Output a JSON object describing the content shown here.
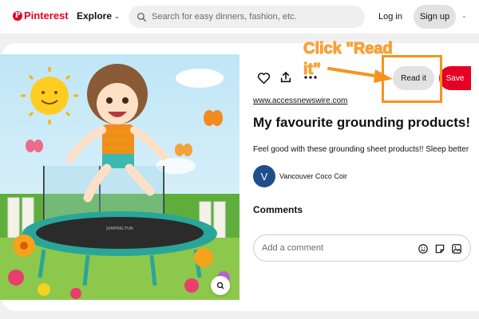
{
  "header": {
    "logo_text": "Pinterest",
    "explore_label": "Explore",
    "search_placeholder": "Search for easy dinners, fashion, etc.",
    "login_label": "Log in",
    "signup_label": "Sign up"
  },
  "pin": {
    "image_caption": "JUMPING FUN",
    "actions": {
      "like_icon": "heart-icon",
      "share_icon": "share-icon",
      "more_icon": "more-icon",
      "read_it_label": "Read it",
      "save_label": "Save"
    },
    "source_link": "www.accessnewswire.com",
    "title": "My favourite grounding products!",
    "description": "Feel good with these grounding sheet products!! Sleep better",
    "author": {
      "initial": "V",
      "name": "Vancouver Coco Coir"
    },
    "comments": {
      "heading": "Comments",
      "input_placeholder": "Add a comment"
    }
  },
  "annotation": {
    "text": "Click \"Read it\"",
    "color": "#f7941d"
  },
  "colors": {
    "brand": "#e60023",
    "annotation": "#f7941d"
  }
}
